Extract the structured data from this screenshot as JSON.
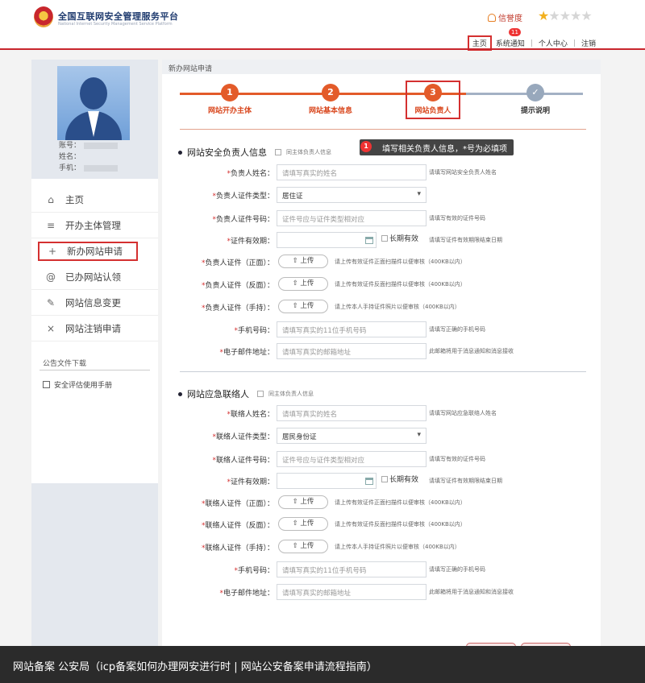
{
  "header": {
    "site_title": "全国互联网安全管理服务平台",
    "site_subtitle": "National Internet Security Management Service Platform",
    "credit_label": "信誉度",
    "rating": 1,
    "rating_max": 5,
    "notification_count": "11",
    "nav": {
      "home": "主页",
      "notifications": "系统通知",
      "personal": "个人中心",
      "logout": "注销"
    }
  },
  "sidebar": {
    "account_label": "账号：",
    "name_label": "姓名：",
    "phone_label": "手机：",
    "menu": [
      {
        "icon": "⌂",
        "label": "主页"
      },
      {
        "icon": "≡",
        "label": "开办主体管理"
      },
      {
        "icon": "+",
        "label": "新办网站申请"
      },
      {
        "icon": "@",
        "label": "已办网站认领"
      },
      {
        "icon": "✎",
        "label": "网站信息变更"
      },
      {
        "icon": "×",
        "label": "网站注销申请"
      }
    ],
    "downloads_title": "公告文件下载",
    "downloads": [
      {
        "label": "安全评估使用手册"
      }
    ]
  },
  "main": {
    "title": "新办网站申请",
    "steps": [
      {
        "num": "1",
        "label": "网站开办主体"
      },
      {
        "num": "2",
        "label": "网站基本信息"
      },
      {
        "num": "3",
        "label": "网站负责人"
      },
      {
        "num": "✓",
        "label": "提示说明"
      }
    ],
    "tooltip": {
      "num": "1",
      "text": "填写相关负责人信息，*号为必填项"
    },
    "section1": {
      "title": "网站安全负责人信息",
      "same_as_owner": "同主体负责人信息",
      "name": {
        "label": "负责人姓名：",
        "placeholder": "请填写真实的姓名",
        "hint": "请填写网站安全负责人姓名"
      },
      "id_type": {
        "label": "负责人证件类型：",
        "value": "居住证"
      },
      "id_no": {
        "label": "负责人证件号码：",
        "placeholder": "证件号应与证件类型相对应",
        "hint": "请填写有效的证件号码"
      },
      "validity": {
        "label": "证件有效期：",
        "longterm": "长期有效",
        "hint": "请填写证件有效期限结束日期"
      },
      "front": {
        "label": "负责人证件（正面）：",
        "button": "上传",
        "hint": "请上传有效证件正面扫描件以便审核（400KB以内）"
      },
      "back": {
        "label": "负责人证件（反面）：",
        "button": "上传",
        "hint": "请上传有效证件反面扫描件以便审核（400KB以内）"
      },
      "hand": {
        "label": "负责人证件（手持）：",
        "button": "上传",
        "hint": "请上传本人手持证件照片以便审核（400KB以内）"
      },
      "mobile": {
        "label": "手机号码：",
        "placeholder": "请填写真实的11位手机号码",
        "hint": "请填写正确的手机号码"
      },
      "email": {
        "label": "电子邮件地址：",
        "placeholder": "请填写真实的邮箱地址",
        "hint": "此邮箱将用于消息通知和消息接收"
      }
    },
    "section2": {
      "title": "网站应急联络人",
      "same_as_owner": "同主体负责人信息",
      "name": {
        "label": "联络人姓名：",
        "placeholder": "请填写真实的姓名",
        "hint": "请填写网站应急联络人姓名"
      },
      "id_type": {
        "label": "联络人证件类型：",
        "value": "居民身份证"
      },
      "id_no": {
        "label": "联络人证件号码：",
        "placeholder": "证件号应与证件类型相对应",
        "hint": "请填写有效的证件号码"
      },
      "validity": {
        "label": "证件有效期：",
        "longterm": "长期有效",
        "hint": "请填写证件有效期限结束日期"
      },
      "front": {
        "label": "联络人证件（正面）：",
        "button": "上传",
        "hint": "请上传有效证件正面扫描件以便审核（400KB以内）"
      },
      "back": {
        "label": "联络人证件（反面）：",
        "button": "上传",
        "hint": "请上传有效证件反面扫描件以便审核（400KB以内）"
      },
      "hand": {
        "label": "联络人证件（手持）：",
        "button": "上传",
        "hint": "请上传本人手持证件照片以便审核（400KB以内）"
      },
      "mobile": {
        "label": "手机号码：",
        "placeholder": "请填写真实的11位手机号码",
        "hint": "请填写正确的手机号码"
      },
      "email": {
        "label": "电子邮件地址：",
        "placeholder": "请填写真实的邮箱地址",
        "hint": "此邮箱将用于消息通知和消息接收"
      }
    }
  },
  "caption": "网站备案 公安局（icp备案如何办理网安进行时 | 网站公安备案申请流程指南）"
}
